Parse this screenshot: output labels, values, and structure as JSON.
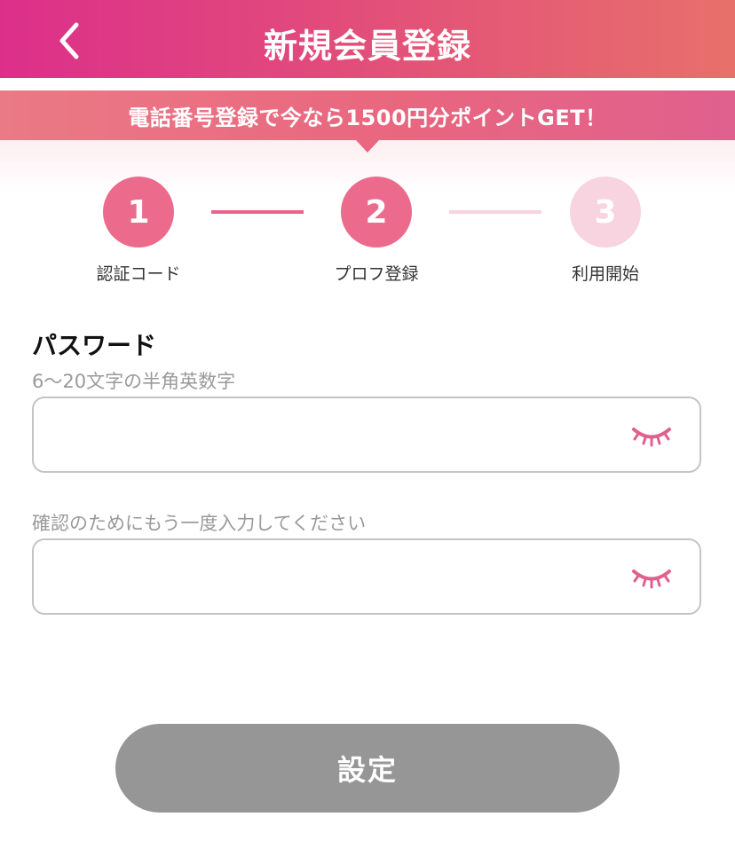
{
  "header": {
    "title": "新規会員登録",
    "back_icon": "chevron-left-icon"
  },
  "promo": {
    "text": "電話番号登録で今なら1500円分ポイントGET！"
  },
  "steps": [
    {
      "number": "1",
      "label": "認証コード",
      "status": "done"
    },
    {
      "number": "2",
      "label": "プロフ登録",
      "status": "current"
    },
    {
      "number": "3",
      "label": "利用開始",
      "status": "todo"
    }
  ],
  "password": {
    "title": "パスワード",
    "hint": "6〜20文字の半角英数字",
    "value": "",
    "toggle_icon": "eye-closed-icon"
  },
  "confirm": {
    "hint": "確認のためにもう一度入力してください",
    "value": "",
    "toggle_icon": "eye-closed-icon"
  },
  "submit": {
    "label": "設定"
  },
  "colors": {
    "header_start": "#dc2f8a",
    "header_end": "#e8706b",
    "accent": "#ec6a8c",
    "inactive_step": "#f7d4df",
    "button_disabled": "#969696"
  }
}
